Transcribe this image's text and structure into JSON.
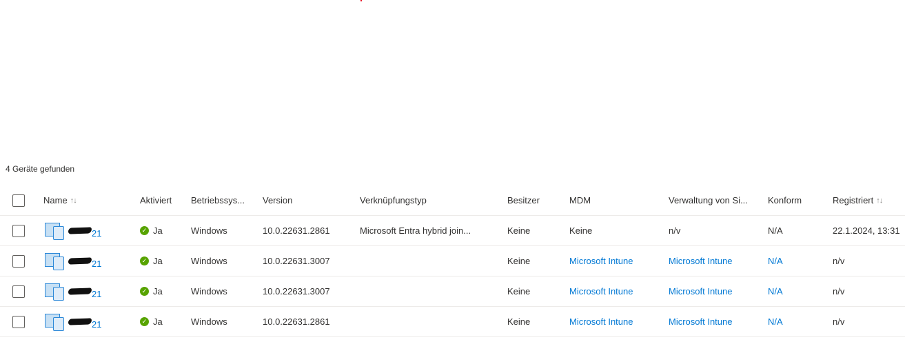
{
  "result_count": "4 Geräte gefunden",
  "columns": {
    "name": "Name",
    "activated": "Aktiviert",
    "os": "Betriebssys...",
    "version": "Version",
    "join_type": "Verknüpfungstyp",
    "owner": "Besitzer",
    "mdm": "MDM",
    "managed_by": "Verwaltung von Si...",
    "compliant": "Konform",
    "registered": "Registriert"
  },
  "sort_icon": "↑↓",
  "rows": [
    {
      "name_suffix": "21",
      "activated": "Ja",
      "os": "Windows",
      "version": "10.0.22631.2861",
      "join_type": "Microsoft Entra hybrid join...",
      "owner": "Keine",
      "mdm": "Keine",
      "managed_by": "n/v",
      "compliant": "N/A",
      "registered": "22.1.2024, 13:31"
    },
    {
      "name_suffix": "21",
      "activated": "Ja",
      "os": "Windows",
      "version": "10.0.22631.3007",
      "join_type": "",
      "owner": "Keine",
      "mdm": "Microsoft Intune",
      "managed_by": "Microsoft Intune",
      "compliant": "N/A",
      "registered": "n/v"
    },
    {
      "name_suffix": "21",
      "activated": "Ja",
      "os": "Windows",
      "version": "10.0.22631.3007",
      "join_type": "",
      "owner": "Keine",
      "mdm": "Microsoft Intune",
      "managed_by": "Microsoft Intune",
      "compliant": "N/A",
      "registered": "n/v"
    },
    {
      "name_suffix": "21",
      "activated": "Ja",
      "os": "Windows",
      "version": "10.0.22631.2861",
      "join_type": "",
      "owner": "Keine",
      "mdm": "Microsoft Intune",
      "managed_by": "Microsoft Intune",
      "compliant": "N/A",
      "registered": "n/v"
    }
  ],
  "colors": {
    "link": "#0078d4",
    "success": "#57a300"
  }
}
